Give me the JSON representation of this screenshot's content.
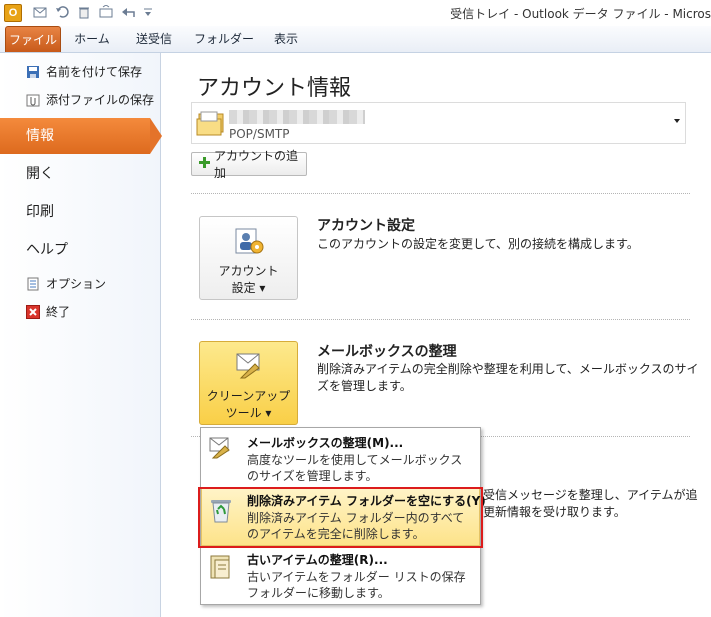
{
  "window": {
    "title": "受信トレイ - Outlook データ ファイル - Micros"
  },
  "quick_access": {
    "icons": [
      "outlook-app-icon",
      "new-mail-icon",
      "undo-icon",
      "delete-icon",
      "send-receive-icon",
      "reply-icon",
      "customize-icon"
    ]
  },
  "ribbon": {
    "tabs": [
      "ファイル",
      "ホーム",
      "送受信",
      "フォルダー",
      "表示"
    ]
  },
  "nav": {
    "save_as": "名前を付けて保存",
    "save_attachments": "添付ファイルの保存",
    "info": "情報",
    "open": "開く",
    "print": "印刷",
    "help": "ヘルプ",
    "options": "オプション",
    "exit": "終了"
  },
  "main": {
    "title": "アカウント情報",
    "account": {
      "type": "POP/SMTP"
    },
    "add_account": "アカウントの追加",
    "account_settings": {
      "button_line1": "アカウント",
      "button_line2": "設定 ▾",
      "title": "アカウント設定",
      "desc": "このアカウントの設定を変更して、別の接続を構成します。"
    },
    "mailbox_cleanup": {
      "button_line1": "クリーンアップ",
      "button_line2": "ツール ▾",
      "title": "メールボックスの整理",
      "desc_line1": "削除済みアイテムの完全削除や整理を利用して、メールボックスのサイ",
      "desc_line2": "ズを管理します。"
    },
    "rules_partial": {
      "line1": "受信メッセージを整理し、アイテムが追",
      "line2": "更新情報を受け取ります。"
    }
  },
  "menu": {
    "items": [
      {
        "title": "メールボックスの整理(M)...",
        "desc": "高度なツールを使用してメールボックスのサイズを管理します。"
      },
      {
        "title": "削除済みアイテム フォルダーを空にする(Y)",
        "desc": "削除済みアイテム フォルダー内のすべてのアイテムを完全に削除します。"
      },
      {
        "title": "古いアイテムの整理(R)...",
        "desc": "古いアイテムをフォルダー リストの保存フォルダーに移動します。"
      }
    ]
  }
}
